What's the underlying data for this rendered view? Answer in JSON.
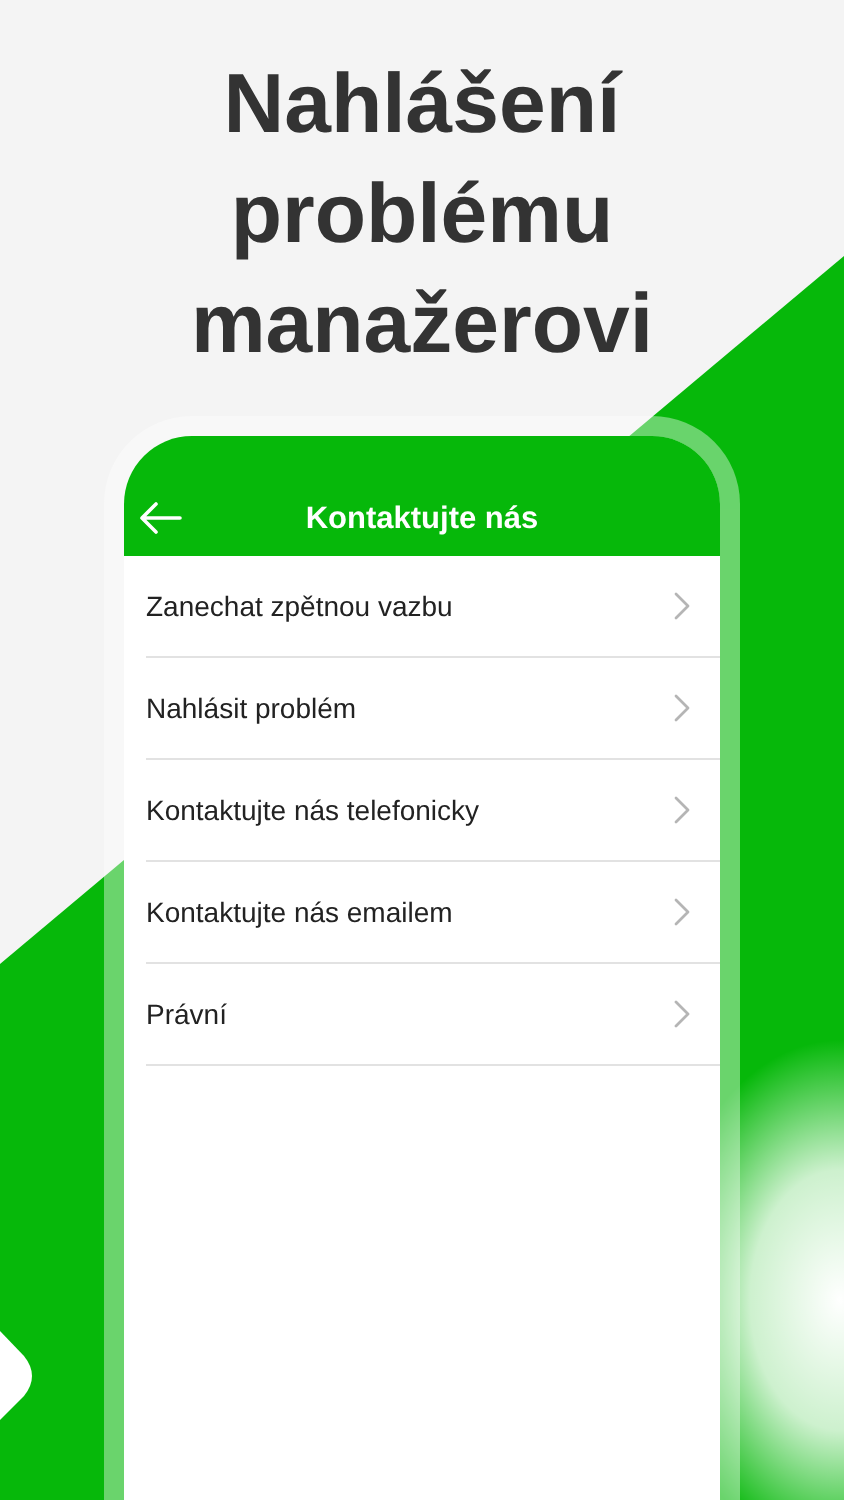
{
  "headline": "Nahlášení problému manažerovi",
  "screen": {
    "title": "Kontaktujte nás"
  },
  "menu": [
    {
      "label": "Zanechat zpětnou vazbu"
    },
    {
      "label": "Nahlásit problém"
    },
    {
      "label": "Kontaktujte nás telefonicky"
    },
    {
      "label": "Kontaktujte nás emailem"
    },
    {
      "label": "Právní"
    }
  ]
}
